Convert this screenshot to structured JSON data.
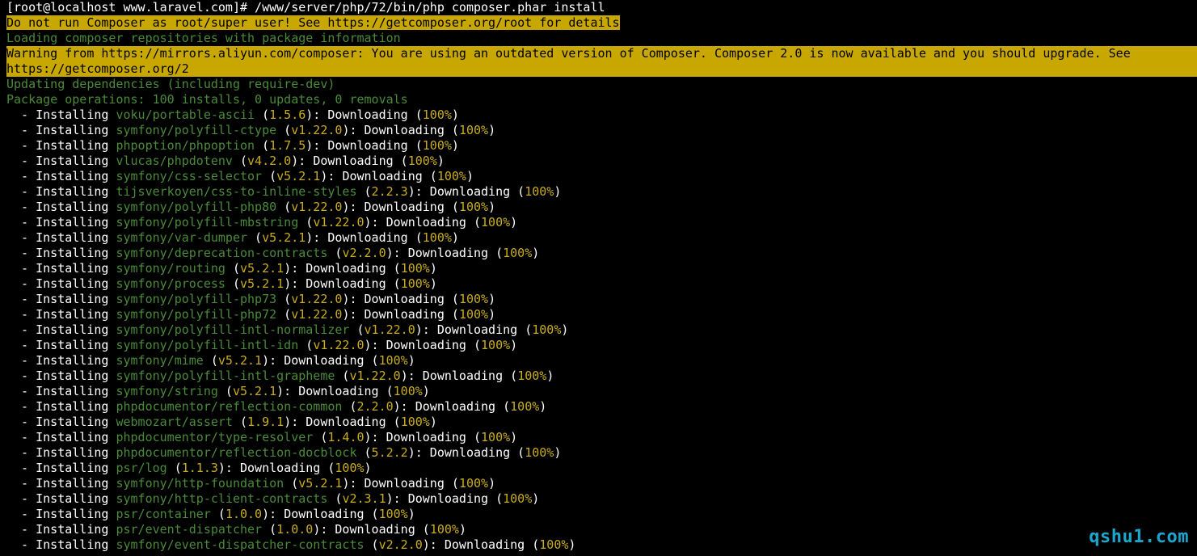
{
  "terminal": {
    "prompt": "[root@localhost www.laravel.com]#",
    "command": " /www/server/php/72/bin/php composer.phar install",
    "root_warning": "Do not run Composer as root/super user! See https://getcomposer.org/root for details",
    "loading": "Loading composer repositories with package information",
    "mirror_warning_line1": "Warning from https://mirrors.aliyun.com/composer: You are using an outdated version of Composer. Composer 2.0 is now available and you should upgrade. See",
    "mirror_warning_line2": "https://getcomposer.org/2",
    "updating": "Updating dependencies (including require-dev)",
    "operations": "Package operations: 100 installs, 0 updates, 0 removals",
    "install_prefix": "  - Installing ",
    "downloading_label": "Downloading",
    "percent": "100%",
    "packages": [
      {
        "name": "voku/portable-ascii",
        "version": "1.5.6"
      },
      {
        "name": "symfony/polyfill-ctype",
        "version": "v1.22.0"
      },
      {
        "name": "phpoption/phpoption",
        "version": "1.7.5"
      },
      {
        "name": "vlucas/phpdotenv",
        "version": "v4.2.0"
      },
      {
        "name": "symfony/css-selector",
        "version": "v5.2.1"
      },
      {
        "name": "tijsverkoyen/css-to-inline-styles",
        "version": "2.2.3"
      },
      {
        "name": "symfony/polyfill-php80",
        "version": "v1.22.0"
      },
      {
        "name": "symfony/polyfill-mbstring",
        "version": "v1.22.0"
      },
      {
        "name": "symfony/var-dumper",
        "version": "v5.2.1"
      },
      {
        "name": "symfony/deprecation-contracts",
        "version": "v2.2.0"
      },
      {
        "name": "symfony/routing",
        "version": "v5.2.1"
      },
      {
        "name": "symfony/process",
        "version": "v5.2.1"
      },
      {
        "name": "symfony/polyfill-php73",
        "version": "v1.22.0"
      },
      {
        "name": "symfony/polyfill-php72",
        "version": "v1.22.0"
      },
      {
        "name": "symfony/polyfill-intl-normalizer",
        "version": "v1.22.0"
      },
      {
        "name": "symfony/polyfill-intl-idn",
        "version": "v1.22.0"
      },
      {
        "name": "symfony/mime",
        "version": "v5.2.1"
      },
      {
        "name": "symfony/polyfill-intl-grapheme",
        "version": "v1.22.0"
      },
      {
        "name": "symfony/string",
        "version": "v5.2.1"
      },
      {
        "name": "phpdocumentor/reflection-common",
        "version": "2.2.0"
      },
      {
        "name": "webmozart/assert",
        "version": "1.9.1"
      },
      {
        "name": "phpdocumentor/type-resolver",
        "version": "1.4.0"
      },
      {
        "name": "phpdocumentor/reflection-docblock",
        "version": "5.2.2"
      },
      {
        "name": "psr/log",
        "version": "1.1.3"
      },
      {
        "name": "symfony/http-foundation",
        "version": "v5.2.1"
      },
      {
        "name": "symfony/http-client-contracts",
        "version": "v2.3.1"
      },
      {
        "name": "psr/container",
        "version": "1.0.0"
      },
      {
        "name": "psr/event-dispatcher",
        "version": "1.0.0"
      },
      {
        "name": "symfony/event-dispatcher-contracts",
        "version": "v2.2.0"
      }
    ]
  },
  "watermark": "qshu1.com",
  "colors": {
    "background": "#000000",
    "highlight": "#c8a800",
    "green": "#4a8a3a",
    "yellow": "#c9ad1f",
    "watermark": "#19a7ce"
  }
}
